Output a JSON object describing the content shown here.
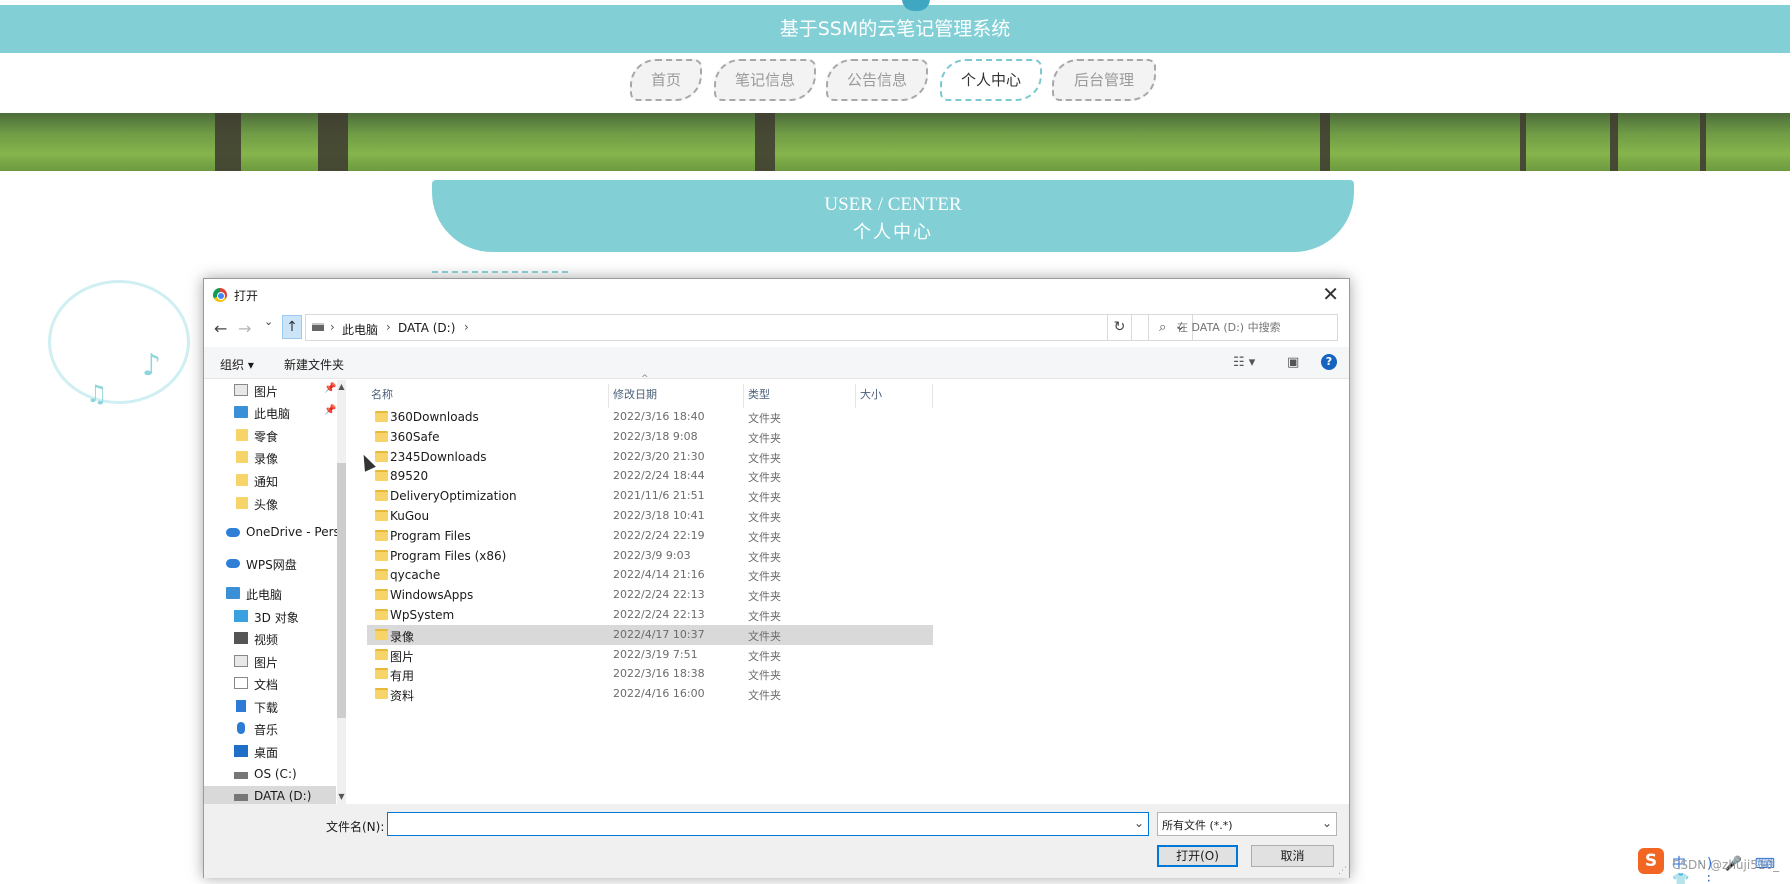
{
  "site": {
    "title": "基于SSM的云笔记管理系统",
    "nav": [
      "首页",
      "笔记信息",
      "公告信息",
      "个人中心",
      "后台管理"
    ],
    "active_nav": "个人中心",
    "section_en": "USER / CENTER",
    "section_cn": "个人中心"
  },
  "dialog": {
    "title": "打开",
    "close": "✕",
    "back": "←",
    "forward": "→",
    "recent": "⌄",
    "up": "↑",
    "breadcrumb": [
      "此电脑",
      "DATA (D:)"
    ],
    "crumb_sep": "›",
    "refresh": "↻",
    "search_placeholder": "在 DATA (D:) 中搜索",
    "toolbar": {
      "organize": "组织 ▾",
      "new_folder": "新建文件夹"
    },
    "help": "?",
    "nav_items": [
      {
        "label": "图片",
        "icon": "pictures-icon",
        "pinned": true
      },
      {
        "label": "此电脑",
        "icon": "computer-icon",
        "pinned": true
      },
      {
        "label": "零食",
        "icon": "folder-icon"
      },
      {
        "label": "录像",
        "icon": "folder-icon"
      },
      {
        "label": "通知",
        "icon": "folder-icon"
      },
      {
        "label": "头像",
        "icon": "folder-icon"
      },
      {
        "label": "OneDrive - Pers",
        "icon": "onedrive-icon"
      },
      {
        "label": "WPS网盘",
        "icon": "wps-cloud-icon"
      },
      {
        "label": "此电脑",
        "icon": "computer-icon"
      },
      {
        "label": "3D 对象",
        "icon": "3d-objects-icon"
      },
      {
        "label": "视频",
        "icon": "videos-icon"
      },
      {
        "label": "图片",
        "icon": "pictures-icon"
      },
      {
        "label": "文档",
        "icon": "documents-icon"
      },
      {
        "label": "下载",
        "icon": "downloads-icon"
      },
      {
        "label": "音乐",
        "icon": "music-icon"
      },
      {
        "label": "桌面",
        "icon": "desktop-icon"
      },
      {
        "label": "OS (C:)",
        "icon": "drive-icon"
      },
      {
        "label": "DATA (D:)",
        "icon": "drive-icon",
        "selected": true
      }
    ],
    "columns": [
      "名称",
      "修改日期",
      "类型",
      "大小"
    ],
    "files": [
      {
        "name": "360Downloads",
        "date": "2022/3/16 18:40",
        "type": "文件夹"
      },
      {
        "name": "360Safe",
        "date": "2022/3/18 9:08",
        "type": "文件夹"
      },
      {
        "name": "2345Downloads",
        "date": "2022/3/20 21:30",
        "type": "文件夹"
      },
      {
        "name": "89520",
        "date": "2022/2/24 18:44",
        "type": "文件夹"
      },
      {
        "name": "DeliveryOptimization",
        "date": "2021/11/6 21:51",
        "type": "文件夹"
      },
      {
        "name": "KuGou",
        "date": "2022/3/18 10:41",
        "type": "文件夹"
      },
      {
        "name": "Program Files",
        "date": "2022/2/24 22:19",
        "type": "文件夹"
      },
      {
        "name": "Program Files (x86)",
        "date": "2022/3/9 9:03",
        "type": "文件夹"
      },
      {
        "name": "qycache",
        "date": "2022/4/14 21:16",
        "type": "文件夹"
      },
      {
        "name": "WindowsApps",
        "date": "2022/2/24 22:13",
        "type": "文件夹"
      },
      {
        "name": "WpSystem",
        "date": "2022/2/24 22:13",
        "type": "文件夹"
      },
      {
        "name": "录像",
        "date": "2022/4/17 10:37",
        "type": "文件夹",
        "selected": true
      },
      {
        "name": "图片",
        "date": "2022/3/19 7:51",
        "type": "文件夹"
      },
      {
        "name": "有用",
        "date": "2022/3/16 18:38",
        "type": "文件夹"
      },
      {
        "name": "资料",
        "date": "2022/4/16 16:00",
        "type": "文件夹"
      }
    ],
    "filename_label": "文件名(N):",
    "filename_value": "",
    "filetype": "所有文件 (*.*)",
    "open_button": "打开(O)",
    "cancel_button": "取消"
  },
  "ime": {
    "logo": "S",
    "icons": "中 ·) 🎤 ⌨ 👕 ⋮"
  },
  "watermark": "CSDN @zhuji510_"
}
